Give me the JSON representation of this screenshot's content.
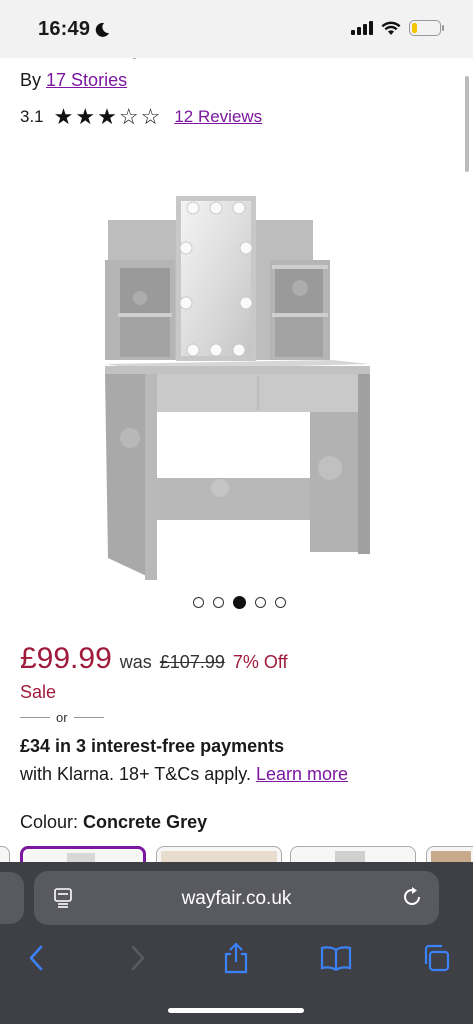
{
  "status_bar": {
    "time": "16:49"
  },
  "product": {
    "brand_prefix": "By",
    "brand": "17 Stories",
    "rating": "3.1",
    "stars_filled": 3,
    "stars_total": 5,
    "reviews_link": "12 Reviews"
  },
  "gallery": {
    "image_count": 5,
    "active_index": 2
  },
  "pricing": {
    "price": "£99.99",
    "was_label": "was",
    "was_price": "£107.99",
    "discount": "7% Off",
    "sale_label": "Sale",
    "or_label": "or",
    "klarna_title": "£34 in 3 interest-free payments",
    "klarna_sub": "with Klarna. 18+ T&Cs apply.",
    "learn_more": "Learn more"
  },
  "colour": {
    "label": "Colour:",
    "value": "Concrete Grey"
  },
  "browser": {
    "url": "wayfair.co.uk"
  },
  "colors": {
    "accent": "#7b189f",
    "price": "#a01a3b",
    "browser_bar": "#3f3f46",
    "browser_icon": "#3b82f6"
  }
}
